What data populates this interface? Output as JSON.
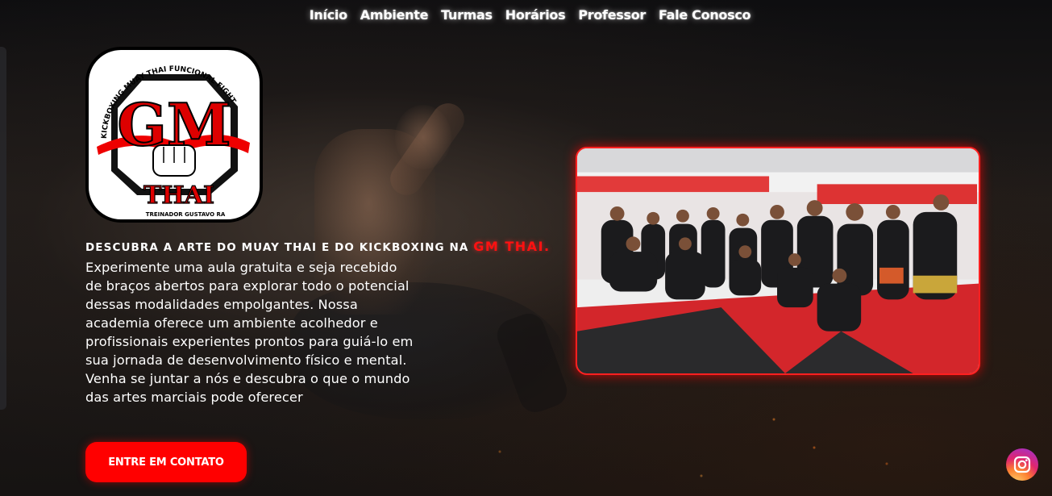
{
  "nav": {
    "items": [
      {
        "label": "Início"
      },
      {
        "label": "Ambiente"
      },
      {
        "label": "Turmas"
      },
      {
        "label": "Horários"
      },
      {
        "label": "Professor"
      },
      {
        "label": "Fale Conosco"
      }
    ]
  },
  "logo": {
    "top_arc": "KICKBOXING   MUAY THAI   FUNCIONAL FIGHT",
    "monogram": "GM",
    "brand": "THAI",
    "trainer": "TREINADOR GUSTAVO RA"
  },
  "hero": {
    "headline_prefix": "DESCUBRA A ARTE DO MUAY THAI E DO KICKBOXING NA ",
    "headline_accent": "GM THAI.",
    "body": "Experimente uma aula gratuita e seja recebido de braços abertos para explorar todo o potencial dessas modalidades empolgantes. Nossa academia oferece um ambiente acolhedor e profissionais experientes prontos para guiá-lo em sua jornada de desenvolvimento físico e mental. Venha se juntar a nós e descubra o que o mundo das artes marciais pode oferecer",
    "cta_label": "ENTRE EM CONTATO"
  },
  "colors": {
    "accent": "#ff0000",
    "background": "#1a1614"
  },
  "icons": {
    "social": "instagram-icon"
  }
}
